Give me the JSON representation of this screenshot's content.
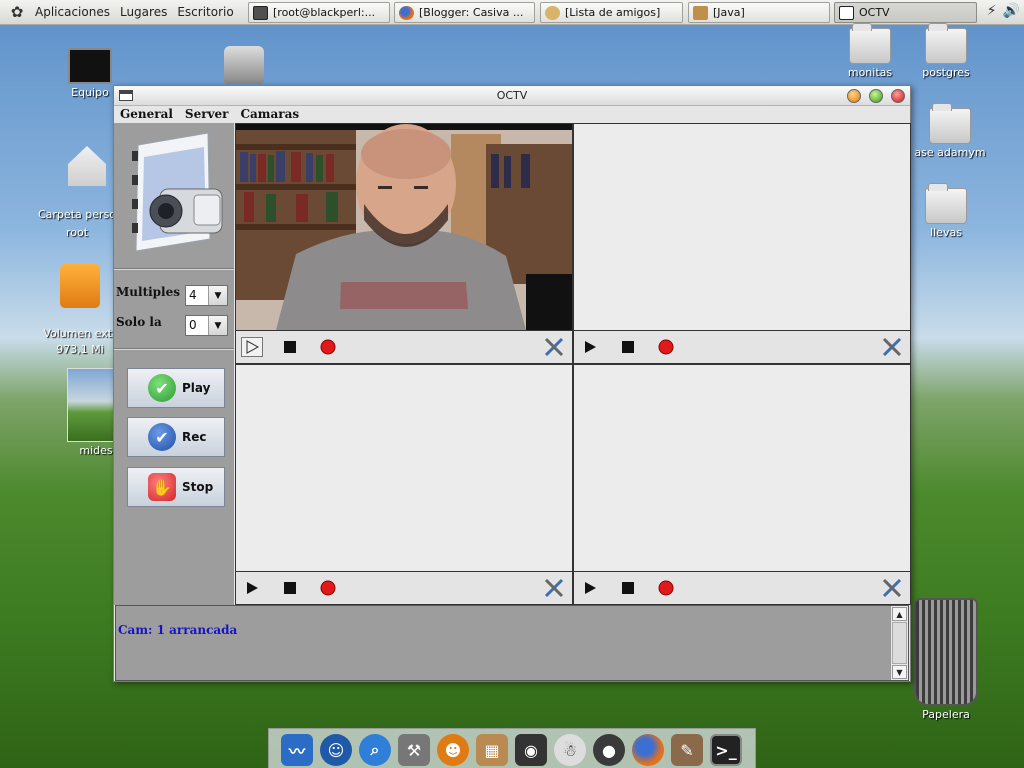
{
  "top_panel": {
    "menus": [
      "Aplicaciones",
      "Lugares",
      "Escritorio"
    ],
    "tasks": [
      {
        "label": "[root@blackperl:...",
        "icon": "terminal-icon",
        "color": "#505050"
      },
      {
        "label": "[Blogger: Casiva ...",
        "icon": "firefox-icon",
        "color": "#e2701c"
      },
      {
        "label": "[Lista de amigos]",
        "icon": "buddy-list-icon",
        "color": "#d9b36a"
      },
      {
        "label": "[Java]",
        "icon": "java-icon",
        "color": "#c0904a"
      },
      {
        "label": "OCTV",
        "icon": "window-icon",
        "color": "#ffffff"
      }
    ]
  },
  "desktop": {
    "icons_left": [
      {
        "label": "Equipo",
        "icon": "computer-icon"
      },
      {
        "label": "Carpeta perso\nroot",
        "icon": "home-folder-icon"
      },
      {
        "label": "Volumen extr\n973,1 Mi",
        "icon": "usb-drive-icon"
      },
      {
        "label": "mides",
        "icon": "screenshot-thumbnail-icon"
      }
    ],
    "icons_right": [
      {
        "label": "monitas",
        "icon": "folder-icon"
      },
      {
        "label": "postgres",
        "icon": "folder-icon"
      },
      {
        "label": "ase adamym",
        "icon": "folder-icon"
      },
      {
        "label": "llevas",
        "icon": "folder-icon"
      },
      {
        "label": "Papelera",
        "icon": "trash-icon"
      }
    ]
  },
  "window": {
    "title": "OCTV",
    "menu": [
      "General",
      "Server",
      "Camaras"
    ],
    "sidebar": {
      "multiples_label": "Multiples",
      "multiples_value": "4",
      "solo_label": "Solo la",
      "solo_value": "0",
      "buttons": [
        {
          "label": "Play",
          "icon": "check-green-icon",
          "color": "#2e9a2e"
        },
        {
          "label": "Rec",
          "icon": "check-blue-icon",
          "color": "#1f4fa8"
        },
        {
          "label": "Stop",
          "icon": "stop-hand-icon",
          "color": "#d2262a"
        }
      ]
    },
    "cameras": [
      {
        "id": 1,
        "active": true
      },
      {
        "id": 2,
        "active": false
      },
      {
        "id": 3,
        "active": false
      },
      {
        "id": 4,
        "active": false
      }
    ],
    "console": {
      "message": "Cam: 1 arrancada"
    }
  },
  "dock": {
    "items": [
      "system-monitor-icon",
      "accessibility-icon",
      "search-icon",
      "tools-icon",
      "pumpkin-icon",
      "package-icon",
      "camera-icon",
      "ghost-icon",
      "speaker-icon",
      "firefox-icon",
      "gimp-icon",
      "terminal-icon"
    ]
  },
  "colors": {
    "accent_blue": "#1515c8",
    "panel_gray": "#9d9d9d",
    "record_red": "#e01a1a"
  }
}
